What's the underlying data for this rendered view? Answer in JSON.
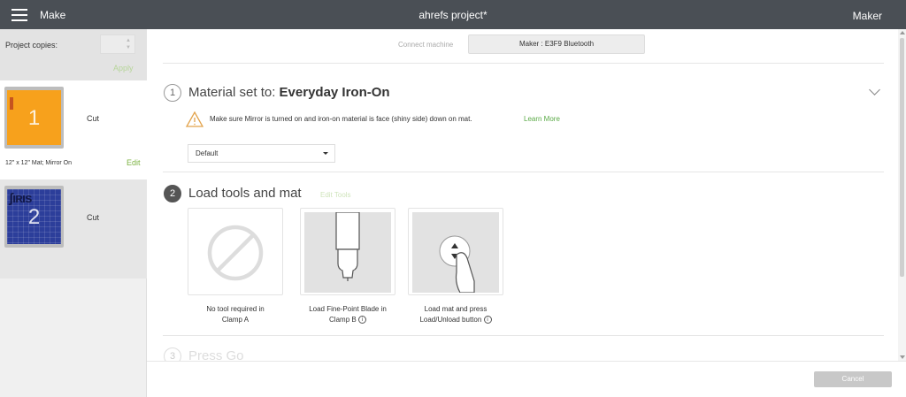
{
  "header": {
    "left_label": "Make",
    "title": "ahrefs project*",
    "right_label": "Maker"
  },
  "sidebar": {
    "copies_label": "Project copies:",
    "apply_label": "Apply",
    "stepper_up": "▲",
    "stepper_down": "▼",
    "mats": [
      {
        "number": "1",
        "action": "Cut",
        "description": "12\" x 12\" Mat; Mirror On",
        "edit_label": "Edit",
        "color": "#f7a11c"
      },
      {
        "number": "2",
        "action": "Cut",
        "glyphs": "ʃıʀıs",
        "color": "#2c3e9a"
      }
    ]
  },
  "connection": {
    "label": "Connect machine",
    "machine": "Maker : E3F9 Bluetooth"
  },
  "steps": [
    {
      "number": "1",
      "title_prefix": "Material set to: ",
      "title_bold": "Everyday Iron-On"
    },
    {
      "number": "2",
      "title": "Load tools and mat",
      "edit_tools": "Edit Tools"
    },
    {
      "number": "3",
      "title": "Press Go"
    }
  ],
  "warning": {
    "text": "Make sure Mirror is turned on and iron-on material is face (shiny side) down on mat.",
    "link": "Learn More"
  },
  "pressure_select": {
    "value": "Default"
  },
  "tools": [
    {
      "line1": "No tool required in",
      "line2": "Clamp A"
    },
    {
      "line1": "Load Fine-Point Blade in",
      "line2": "Clamp B",
      "info": "i"
    },
    {
      "line1": "Load mat and press",
      "line2": "Load/Unload button",
      "info": "i"
    }
  ],
  "footer": {
    "cancel_label": "Cancel"
  },
  "colors": {
    "topbar": "#4a4f55",
    "accent_green": "#7cb342",
    "mat_orange": "#f7a11c",
    "mat_blue": "#2c3e9a"
  }
}
